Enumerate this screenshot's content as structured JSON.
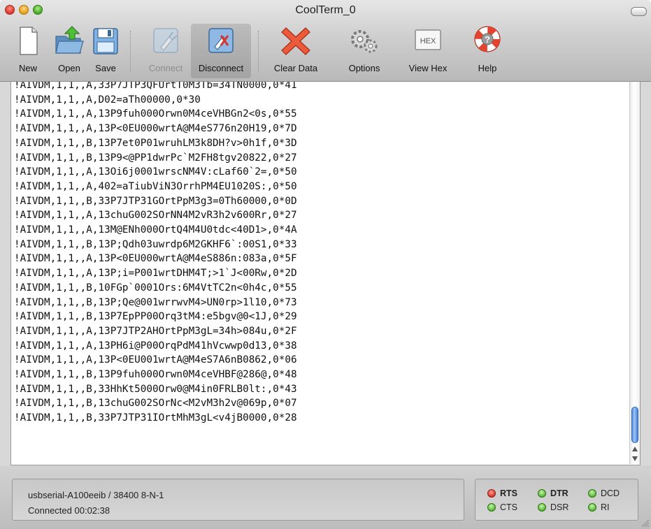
{
  "window": {
    "title": "CoolTerm_0"
  },
  "toolbar": {
    "new": "New",
    "open": "Open",
    "save": "Save",
    "connect": "Connect",
    "disconnect": "Disconnect",
    "clear_data": "Clear Data",
    "options": "Options",
    "view_hex": "View Hex",
    "hex_icon_text": "HEX",
    "help": "Help"
  },
  "terminal": {
    "lines": [
      "!AIVDM,1,1,,A,33P7JTP3QFUrtT0M3Tb=34TN0000,0*41",
      "!AIVDM,1,1,,A,D02=aTh00000,0*30",
      "!AIVDM,1,1,,A,13P9fuh000Orwn0M4ceVHBGn2<0s,0*55",
      "!AIVDM,1,1,,A,13P<0EU000wrtA@M4eS776n20H19,0*7D",
      "!AIVDM,1,1,,B,13P7et0P01wruhLM3k8DH?v>0h1f,0*3D",
      "!AIVDM,1,1,,B,13P9<@PP1dwrPc`M2FH8tgv20822,0*27",
      "!AIVDM,1,1,,A,13Oi6j0001wrscNM4V:cLaf60`2=,0*50",
      "!AIVDM,1,1,,A,402=aTiubViN3OrrhPM4EU1020S:,0*50",
      "!AIVDM,1,1,,B,33P7JTP31GOrtPpM3g3=0Th60000,0*0D",
      "!AIVDM,1,1,,A,13chuG002SOrNN4M2vR3h2v600Rr,0*27",
      "!AIVDM,1,1,,A,13M@ENh000OrtQ4M4U0tdc<40D1>,0*4A",
      "!AIVDM,1,1,,B,13P;Qdh03uwrdp6M2GKHF6`:00S1,0*33",
      "!AIVDM,1,1,,A,13P<0EU000wrtA@M4eS886n:083a,0*5F",
      "!AIVDM,1,1,,A,13P;i=P001wrtDHM4T;>1`J<00Rw,0*2D",
      "!AIVDM,1,1,,B,10FGp`0001Ors:6M4VtTC2n<0h4c,0*55",
      "!AIVDM,1,1,,B,13P;Qe@001wrrwvM4>UN0rp>1l10,0*73",
      "!AIVDM,1,1,,B,13P7EpPP00Orq3tM4:e5bgv@0<1J,0*29",
      "!AIVDM,1,1,,A,13P7JTP2AHOrtPpM3gL=34h>084u,0*2F",
      "!AIVDM,1,1,,A,13PH6i@P00OrqPdM41hVcwwp0d13,0*38",
      "!AIVDM,1,1,,A,13P<0EU001wrtA@M4eS7A6nB0862,0*06",
      "!AIVDM,1,1,,B,13P9fuh000Orwn0M4ceVHBF@286@,0*48",
      "!AIVDM,1,1,,B,33HhKt5000Orw0@M4in0FRLB0lt:,0*43",
      "!AIVDM,1,1,,B,13chuG002SOrNc<M2vM3h2v@069p,0*07",
      "!AIVDM,1,1,,B,33P7JTP31IOrtMhM3gL<v4jB0000,0*28"
    ]
  },
  "status": {
    "port": "usbserial-A100eeib / 38400 8-N-1",
    "connection": "Connected 00:02:38"
  },
  "signals": {
    "rts": "RTS",
    "dtr": "DTR",
    "dcd": "DCD",
    "cts": "CTS",
    "dsr": "DSR",
    "ri": "RI"
  },
  "colors": {
    "led_active": "#d8362b",
    "led_ok": "#59b53a",
    "scroll_thumb": "#4d8de3"
  }
}
